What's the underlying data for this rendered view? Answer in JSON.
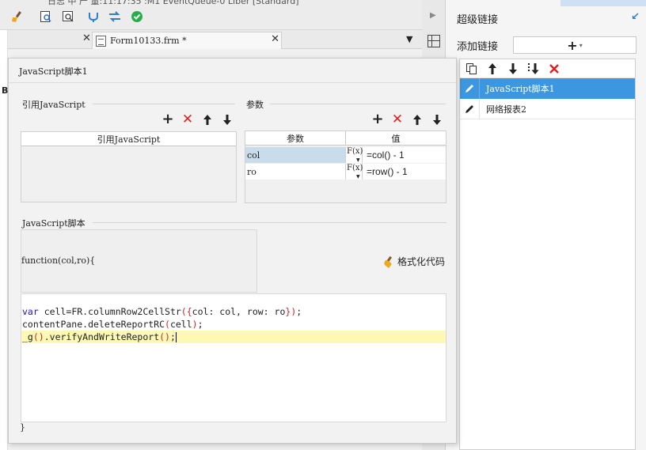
{
  "topbar": {
    "title_fragment": "日志 中 产 量:11:17:35 :M1 EventQueue-0 Liber [Standard]",
    "icons": [
      "brush-icon",
      "search-doc-icon",
      "zoom-doc-icon",
      "connect-icon",
      "swap-icon",
      "check-icon"
    ]
  },
  "tabs": {
    "close_symbol": "✕",
    "active_tab_label": "Form10133.frm *",
    "menu_symbol": "▼"
  },
  "background_fragment": "B",
  "right_panel": {
    "title": "超级链接",
    "add_link_label": "添加链接",
    "add_symbol": "+",
    "caret": "▾",
    "toolbar_icons": [
      "copy-icon",
      "arrow-up-icon",
      "arrow-down-icon",
      "move-bottom-icon",
      "delete-icon"
    ],
    "items": [
      {
        "label": "JavaScript脚本1",
        "selected": true
      },
      {
        "label": "网络报表2",
        "selected": false
      }
    ]
  },
  "dialog": {
    "title": "JavaScript脚本1",
    "ref_js": {
      "group_label": "引用JavaScript",
      "column_header": "引用JavaScript",
      "rows": []
    },
    "params": {
      "group_label": "参数",
      "columns": [
        "参数",
        "值"
      ],
      "rows": [
        {
          "name": "col",
          "fx": "F(x)",
          "value": "=col() - 1",
          "selected": true
        },
        {
          "name": "ro",
          "fx": "F(x)",
          "value": "=row() - 1",
          "selected": false
        }
      ]
    },
    "script": {
      "group_label": "JavaScript脚本",
      "function_signature": "function(col,ro){",
      "format_button_label": "格式化代码",
      "code_lines": [
        "var cell=FR.columnRow2CellStr({col: col, row: ro});",
        "contentPane.deleteReportRC(cell);",
        "_g().verifyAndWriteReport();"
      ],
      "closing_brace": "}"
    }
  },
  "colors": {
    "selection_blue": "#3c97e0",
    "param_selected": "#c9dceb",
    "current_line": "#fdf9b4",
    "delete_red": "#e02020",
    "keyword_blue": "#1a1ab8",
    "paren_red": "#c82828"
  }
}
